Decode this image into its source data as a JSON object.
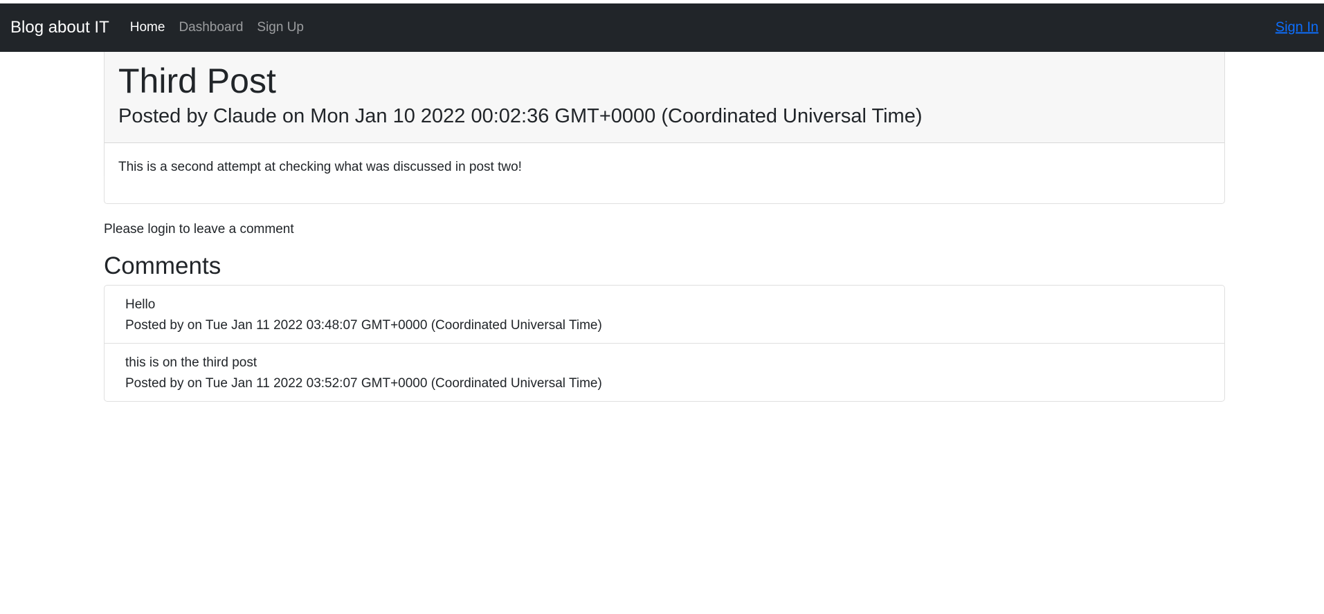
{
  "navbar": {
    "brand": "Blog about IT",
    "links": [
      {
        "label": "Home",
        "active": true
      },
      {
        "label": "Dashboard",
        "active": false
      },
      {
        "label": "Sign Up",
        "active": false
      }
    ],
    "signin_label": "Sign In"
  },
  "post": {
    "title": "Third Post",
    "meta": "Posted by Claude on Mon Jan 10 2022 00:02:36 GMT+0000 (Coordinated Universal Time)",
    "body": "This is a second attempt at checking what was discussed in post two!"
  },
  "login_note": "Please login to leave a comment",
  "comments": {
    "heading": "Comments",
    "items": [
      {
        "text": "Hello",
        "meta": "Posted by on Tue Jan 11 2022 03:48:07 GMT+0000 (Coordinated Universal Time)"
      },
      {
        "text": "this is on the third post",
        "meta": "Posted by on Tue Jan 11 2022 03:52:07 GMT+0000 (Coordinated Universal Time)"
      }
    ]
  },
  "colors": {
    "navbar_bg": "#212529",
    "link_blue": "#0d6efd",
    "card_header_bg": "#f7f7f7"
  }
}
